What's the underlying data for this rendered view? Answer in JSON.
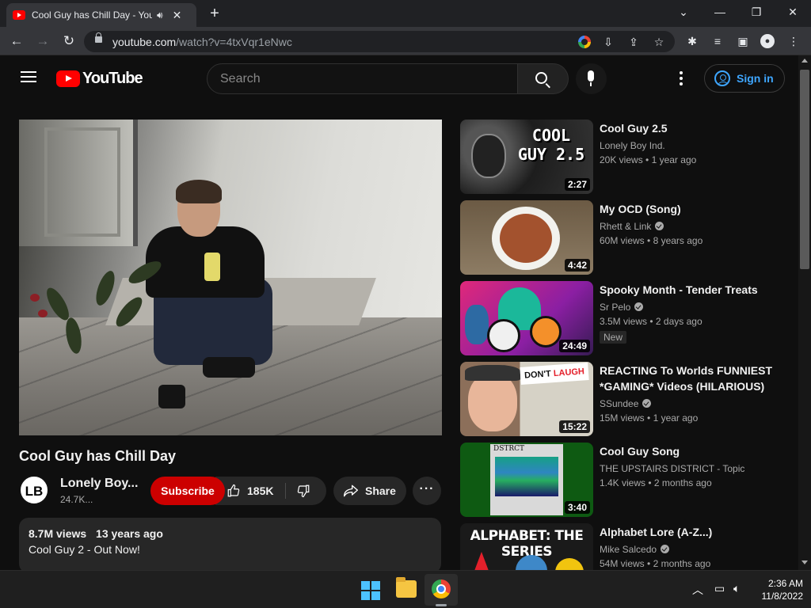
{
  "browser": {
    "tab_title": "Cool Guy has Chill Day - YouTube",
    "url_domain": "youtube.com",
    "url_path": "/watch?v=4txVqr1eNwc"
  },
  "header": {
    "logo_text": "YouTube",
    "search_placeholder": "Search",
    "signin_label": "Sign in"
  },
  "video": {
    "title": "Cool Guy has Chill Day",
    "channel_initials": "LB",
    "channel_name": "Lonely Boy...",
    "subscribers": "24.7K...",
    "subscribe_label": "Subscribe",
    "likes": "185K",
    "share_label": "Share",
    "more_label": "···",
    "views": "8.7M views",
    "age": "13 years ago",
    "description": "Cool Guy 2 - Out Now!"
  },
  "recommendations": [
    {
      "title": "Cool Guy 2.5",
      "channel": "Lonely Boy Ind.",
      "verified": false,
      "views": "20K views",
      "age": "1 year ago",
      "duration": "2:27",
      "thumb_text": "COOL GUY 2.5"
    },
    {
      "title": "My OCD (Song)",
      "channel": "Rhett & Link",
      "verified": true,
      "views": "60M views",
      "age": "8 years ago",
      "duration": "4:42"
    },
    {
      "title": "Spooky Month - Tender Treats",
      "channel": "Sr Pelo",
      "verified": true,
      "views": "3.5M views",
      "age": "2 days ago",
      "duration": "24:49",
      "badge": "New"
    },
    {
      "title": "REACTING To Worlds FUNNIEST *GAMING* Videos (HILARIOUS)",
      "channel": "SSundee",
      "verified": true,
      "views": "15M views",
      "age": "1 year ago",
      "duration": "15:22",
      "thumb_text_a": "DON'T",
      "thumb_text_b": "LAUGH"
    },
    {
      "title": "Cool Guy Song",
      "channel": "THE UPSTAIRS DISTRICT - Topic",
      "verified": false,
      "views": "1.4K views",
      "age": "2 months ago",
      "duration": "3:40",
      "thumb_text": "DSTRCT"
    },
    {
      "title": "Alphabet Lore (A-Z...)",
      "channel": "Mike Salcedo",
      "verified": true,
      "views": "54M views",
      "age": "2 months ago",
      "thumb_text": "ALPHABET: THE SERIES"
    }
  ],
  "taskbar": {
    "time": "2:36 AM",
    "date": "11/8/2022"
  }
}
